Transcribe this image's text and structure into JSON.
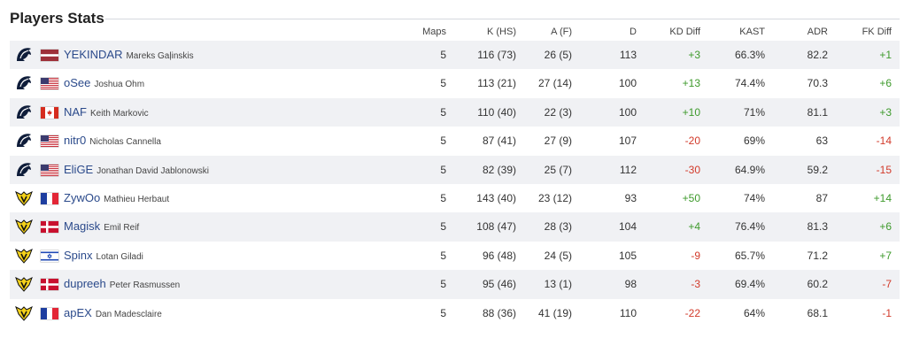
{
  "section": {
    "title": "Players Stats"
  },
  "columns": {
    "maps": "Maps",
    "k": "K (HS)",
    "a": "A (F)",
    "d": "D",
    "kd_diff": "KD Diff",
    "kast": "KAST",
    "adr": "ADR",
    "fk_diff": "FK Diff"
  },
  "colors": {
    "positive": "#3e9a2c",
    "negative": "#d23a2a",
    "nick": "#2b4a8b",
    "stripe": "#f0f1f4"
  },
  "players": [
    {
      "team_icon": "liquid-horse-icon",
      "flag": "latvia",
      "nick": "YEKINDAR",
      "name": "Mareks Gaļinskis",
      "maps": "5",
      "k": "116 (73)",
      "a": "26 (5)",
      "d": "113",
      "kd_diff": "+3",
      "kast": "66.3%",
      "adr": "82.2",
      "fk_diff": "+1"
    },
    {
      "team_icon": "liquid-horse-icon",
      "flag": "usa",
      "nick": "oSee",
      "name": "Joshua Ohm",
      "maps": "5",
      "k": "113 (21)",
      "a": "27 (14)",
      "d": "100",
      "kd_diff": "+13",
      "kast": "74.4%",
      "adr": "70.3",
      "fk_diff": "+6"
    },
    {
      "team_icon": "liquid-horse-icon",
      "flag": "canada",
      "nick": "NAF",
      "name": "Keith Markovic",
      "maps": "5",
      "k": "110 (40)",
      "a": "22 (3)",
      "d": "100",
      "kd_diff": "+10",
      "kast": "71%",
      "adr": "81.1",
      "fk_diff": "+3"
    },
    {
      "team_icon": "liquid-horse-icon",
      "flag": "usa",
      "nick": "nitr0",
      "name": "Nicholas Cannella",
      "maps": "5",
      "k": "87 (41)",
      "a": "27 (9)",
      "d": "107",
      "kd_diff": "-20",
      "kast": "69%",
      "adr": "63",
      "fk_diff": "-14"
    },
    {
      "team_icon": "liquid-horse-icon",
      "flag": "usa",
      "nick": "EliGE",
      "name": "Jonathan David Jablonowski",
      "maps": "5",
      "k": "82 (39)",
      "a": "25 (7)",
      "d": "112",
      "kd_diff": "-30",
      "kast": "64.9%",
      "adr": "59.2",
      "fk_diff": "-15"
    },
    {
      "team_icon": "vitality-bee-icon",
      "flag": "france",
      "nick": "ZywOo",
      "name": "Mathieu Herbaut",
      "maps": "5",
      "k": "143 (40)",
      "a": "23 (12)",
      "d": "93",
      "kd_diff": "+50",
      "kast": "74%",
      "adr": "87",
      "fk_diff": "+14"
    },
    {
      "team_icon": "vitality-bee-icon",
      "flag": "denmark",
      "nick": "Magisk",
      "name": "Emil Reif",
      "maps": "5",
      "k": "108 (47)",
      "a": "28 (3)",
      "d": "104",
      "kd_diff": "+4",
      "kast": "76.4%",
      "adr": "81.3",
      "fk_diff": "+6"
    },
    {
      "team_icon": "vitality-bee-icon",
      "flag": "israel",
      "nick": "Spinx",
      "name": "Lotan Giladi",
      "maps": "5",
      "k": "96 (48)",
      "a": "24 (5)",
      "d": "105",
      "kd_diff": "-9",
      "kast": "65.7%",
      "adr": "71.2",
      "fk_diff": "+7"
    },
    {
      "team_icon": "vitality-bee-icon",
      "flag": "denmark",
      "nick": "dupreeh",
      "name": "Peter Rasmussen",
      "maps": "5",
      "k": "95 (46)",
      "a": "13 (1)",
      "d": "98",
      "kd_diff": "-3",
      "kast": "69.4%",
      "adr": "60.2",
      "fk_diff": "-7"
    },
    {
      "team_icon": "vitality-bee-icon",
      "flag": "france",
      "nick": "apEX",
      "name": "Dan Madesclaire",
      "maps": "5",
      "k": "88 (36)",
      "a": "41 (19)",
      "d": "110",
      "kd_diff": "-22",
      "kast": "64%",
      "adr": "68.1",
      "fk_diff": "-1"
    }
  ]
}
